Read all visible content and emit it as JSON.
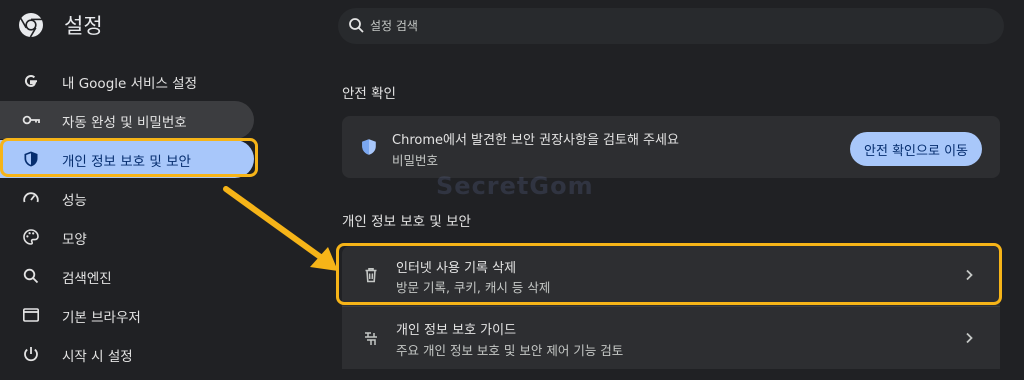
{
  "app": {
    "title": "설정"
  },
  "search": {
    "placeholder": "설정 검색",
    "icon": "search-icon"
  },
  "sidebar": {
    "items": [
      {
        "label": "내 Google 서비스 설정",
        "icon": "google-icon"
      },
      {
        "label": "자동 완성 및 비밀번호",
        "icon": "key-icon"
      },
      {
        "label": "개인 정보 보호 및 보안",
        "icon": "shield-icon"
      },
      {
        "label": "성능",
        "icon": "speed-icon"
      },
      {
        "label": "모양",
        "icon": "palette-icon"
      },
      {
        "label": "검색엔진",
        "icon": "search-icon"
      },
      {
        "label": "기본 브라우저",
        "icon": "browser-window-icon"
      },
      {
        "label": "시작 시 설정",
        "icon": "power-icon"
      }
    ],
    "active_index": 2
  },
  "safety_check": {
    "section_title": "안전 확인",
    "title": "Chrome에서 발견한 보안 권장사항을 검토해 주세요",
    "subtitle": "비밀번호",
    "button_label": "안전 확인으로 이동",
    "icon": "shield-check-icon"
  },
  "privacy": {
    "section_title": "개인 정보 보호 및 보안",
    "rows": [
      {
        "title": "인터넷 사용 기록 삭제",
        "subtitle": "방문 기록, 쿠키, 캐시 등 삭제",
        "icon": "trash-icon"
      },
      {
        "title": "개인 정보 보호 가이드",
        "subtitle": "주요 개인 정보 보호 및 보안 제어 기능 검토",
        "icon": "privacy-guide-icon"
      }
    ]
  },
  "watermark": "SecretGom",
  "colors": {
    "background": "#202124",
    "active_nav": "#a8c7fa",
    "highlight": "#f6b418",
    "card": "#2d2e31"
  }
}
